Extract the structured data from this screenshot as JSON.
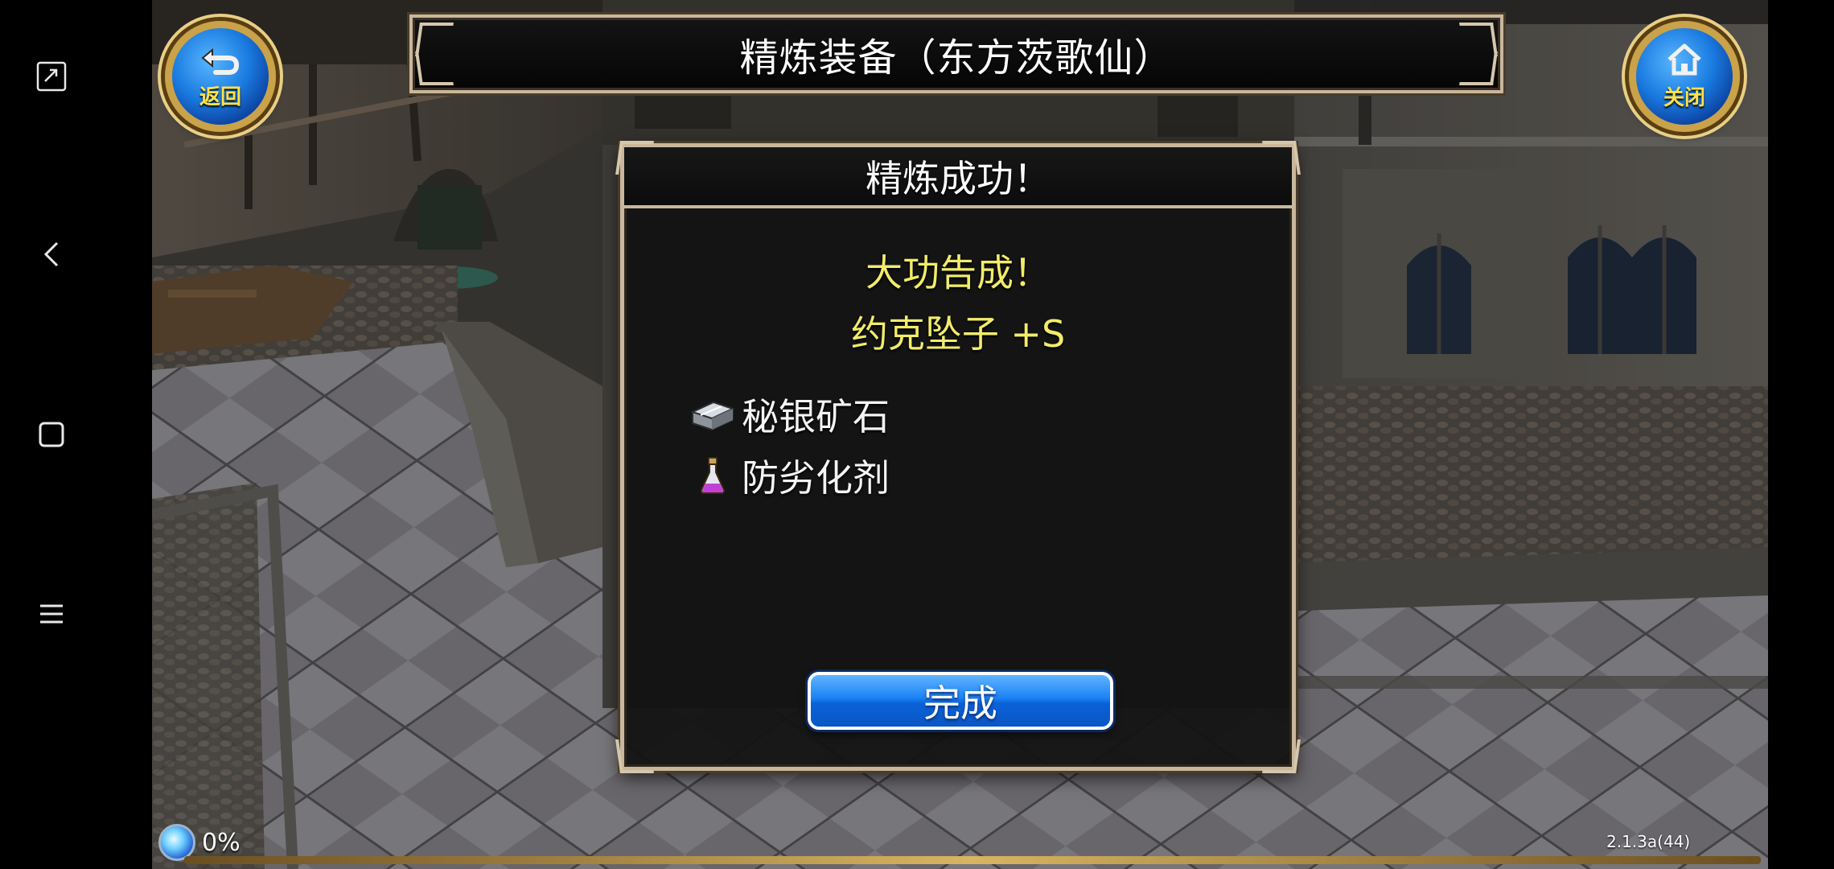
{
  "header": {
    "title": "精炼装备（东方茨歌仙）"
  },
  "corner_buttons": {
    "back_label": "返回",
    "back_icon": "back-arrow-icon",
    "close_label": "关闭",
    "close_icon": "home-icon"
  },
  "dialog": {
    "title": "精炼成功！",
    "result_message": "大功告成！",
    "result_item": "约克坠子 +S",
    "materials": [
      {
        "name": "秘银矿石",
        "icon": "silver-ore-icon"
      },
      {
        "name": "防劣化剂",
        "icon": "potion-icon"
      }
    ],
    "done_label": "完成"
  },
  "status": {
    "percent": "0%",
    "version": "2.1.3a(44)"
  },
  "navbar": {
    "buttons": [
      "fullscreen-icon",
      "back-icon",
      "recent-apps-icon",
      "menu-icon"
    ]
  },
  "colors": {
    "accent_yellow": "#f2ec6a",
    "button_blue": "#1b82f4",
    "frame_beige": "#c9b79d",
    "label_gold": "#ffe24a"
  }
}
